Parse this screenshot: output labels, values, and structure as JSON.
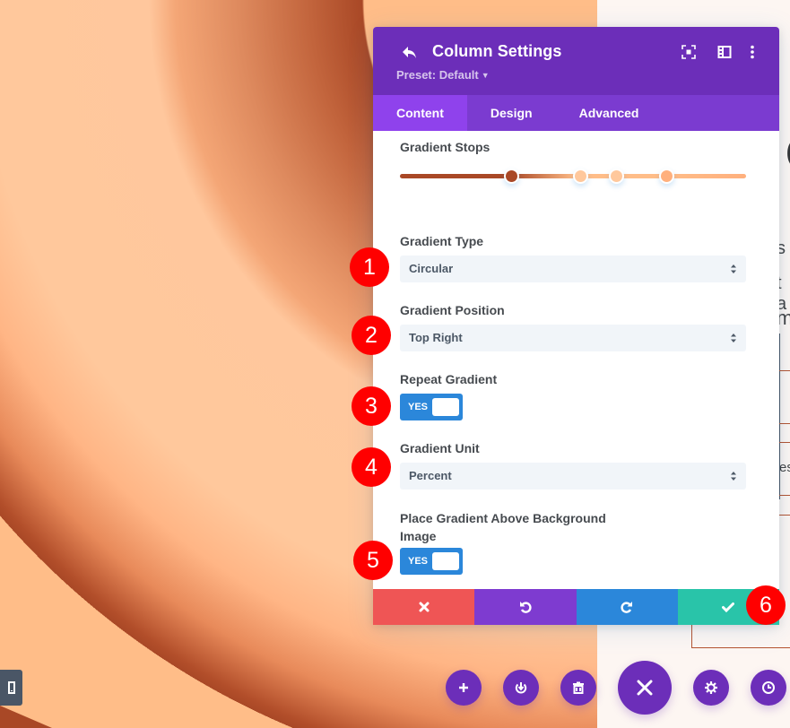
{
  "panel": {
    "title": "Column Settings",
    "preset_label": "Preset: Default",
    "header_icons": [
      "back-arrow-icon",
      "expand-icon",
      "split-view-icon",
      "more-vertical-icon"
    ]
  },
  "tabs": [
    {
      "label": "Content",
      "active": true
    },
    {
      "label": "Design",
      "active": false
    },
    {
      "label": "Advanced",
      "active": false
    }
  ],
  "fields": {
    "gradient_stops": {
      "label": "Gradient Stops",
      "stops": [
        {
          "position_percent": 32,
          "color": "#a94826"
        },
        {
          "position_percent": 52,
          "color": "#ffc89c"
        },
        {
          "position_percent": 62.5,
          "color": "#ffc89c"
        },
        {
          "position_percent": 77,
          "color": "#ffb07d"
        }
      ]
    },
    "gradient_type": {
      "label": "Gradient Type",
      "value": "Circular"
    },
    "gradient_position": {
      "label": "Gradient Position",
      "value": "Top Right"
    },
    "repeat_gradient": {
      "label": "Repeat Gradient",
      "value": "YES"
    },
    "gradient_unit": {
      "label": "Gradient Unit",
      "value": "Percent"
    },
    "place_above_image": {
      "label": "Place Gradient Above Background Image",
      "value": "YES"
    }
  },
  "actions": {
    "cancel": "close-icon",
    "undo": "undo-icon",
    "redo": "redo-icon",
    "save": "check-icon"
  },
  "badges": [
    "1",
    "2",
    "3",
    "4",
    "5",
    "6"
  ],
  "page_fragments": {
    "paren": "(",
    "s": "s",
    "a": "t a",
    "m": "m",
    "es": "es"
  },
  "bottom_toolbar": [
    "add-icon",
    "power-icon",
    "trash-icon",
    "close-icon",
    "gear-icon",
    "history-icon"
  ],
  "colors": {
    "header": "#6c2eb9",
    "tabs": "#7b3bd0",
    "active_tab": "#8f42ec",
    "toggle": "#2b87da",
    "cancel": "#ef5555",
    "undo": "#7e3bd0",
    "redo": "#2b87da",
    "save": "#29c4a9",
    "badge": "#ff0000"
  }
}
